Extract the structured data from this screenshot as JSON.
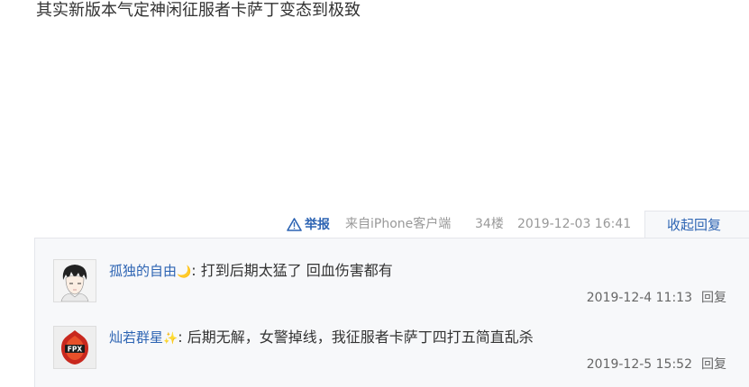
{
  "post": {
    "text": "其实新版本气定神闲征服者卡萨丁变态到极致"
  },
  "meta": {
    "report_label": "举报",
    "source": "来自iPhone客户端",
    "floor": "34楼",
    "time": "2019-12-03 16:41",
    "collapse_label": "收起回复"
  },
  "replies": [
    {
      "username": "孤独的自由",
      "decoration": "🌙",
      "separator": ":",
      "text": "打到后期太猛了 回血伤害都有",
      "time": "2019-12-4 11:13",
      "reply_label": "回复",
      "avatar_icon": "anime-character-avatar"
    },
    {
      "username": "灿若群星",
      "decoration": "✨",
      "separator": ":",
      "text": "后期无解，女警掉线，我征服者卡萨丁四打五简直乱杀",
      "time": "2019-12-5 15:52",
      "reply_label": "回复",
      "avatar_icon": "fpx-logo-avatar",
      "avatar_badge_text": "FPX"
    }
  ],
  "colors": {
    "link": "#2d64b3",
    "meta_gray": "#999999",
    "reply_panel_bg": "#f7f8fa"
  }
}
